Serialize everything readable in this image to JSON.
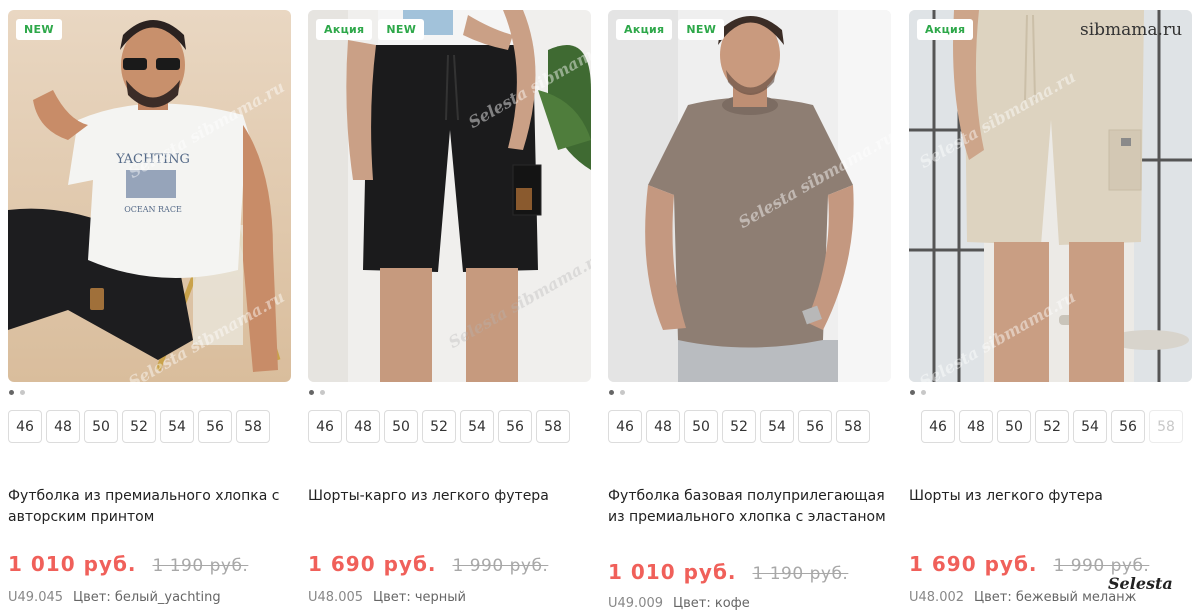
{
  "watermarks": {
    "site": "sibmama.ru",
    "brand": "Selesta",
    "overlay": "Selesta sibmama.ru"
  },
  "colors": {
    "badge_green": "#2ea84a",
    "price_red": "#f0605a"
  },
  "products": [
    {
      "badges": [
        "NEW"
      ],
      "sizes": [
        {
          "label": "46",
          "available": true
        },
        {
          "label": "48",
          "available": true
        },
        {
          "label": "50",
          "available": true
        },
        {
          "label": "52",
          "available": true
        },
        {
          "label": "54",
          "available": true
        },
        {
          "label": "56",
          "available": true
        },
        {
          "label": "58",
          "available": true
        }
      ],
      "title": "Футболка из премиального хлопка с авторским принтом",
      "price": "1 010 руб.",
      "old_price": "1 190 руб.",
      "sku": "U49.045",
      "color": "Цвет: белый_yachting",
      "shirt_print": "YACHTING",
      "shirt_print_sub": "OCEAN RACE"
    },
    {
      "badges": [
        "Акция",
        "NEW"
      ],
      "sizes": [
        {
          "label": "46",
          "available": true
        },
        {
          "label": "48",
          "available": true
        },
        {
          "label": "50",
          "available": true
        },
        {
          "label": "52",
          "available": true
        },
        {
          "label": "54",
          "available": true
        },
        {
          "label": "56",
          "available": true
        },
        {
          "label": "58",
          "available": true
        }
      ],
      "title": "Шорты-карго из легкого футера",
      "price": "1 690 руб.",
      "old_price": "1 990 руб.",
      "sku": "U48.005",
      "color": "Цвет: черный"
    },
    {
      "badges": [
        "Акция",
        "NEW"
      ],
      "sizes": [
        {
          "label": "46",
          "available": true
        },
        {
          "label": "48",
          "available": true
        },
        {
          "label": "50",
          "available": true
        },
        {
          "label": "52",
          "available": true
        },
        {
          "label": "54",
          "available": true
        },
        {
          "label": "56",
          "available": true
        },
        {
          "label": "58",
          "available": true
        }
      ],
      "title": "Футболка базовая полуприлегающая из премиального хлопка с эластаном",
      "price": "1 010 руб.",
      "old_price": "1 190 руб.",
      "sku": "U49.009",
      "color": "Цвет: кофе"
    },
    {
      "badges": [
        "Акция"
      ],
      "sizes": [
        {
          "label": "46",
          "available": true
        },
        {
          "label": "48",
          "available": true
        },
        {
          "label": "50",
          "available": true
        },
        {
          "label": "52",
          "available": true
        },
        {
          "label": "54",
          "available": true
        },
        {
          "label": "56",
          "available": true
        },
        {
          "label": "58",
          "available": false
        }
      ],
      "title": "Шорты из легкого футера",
      "price": "1 690 руб.",
      "old_price": "1 990 руб.",
      "sku": "U48.002",
      "color": "Цвет: бежевый меланж"
    }
  ]
}
